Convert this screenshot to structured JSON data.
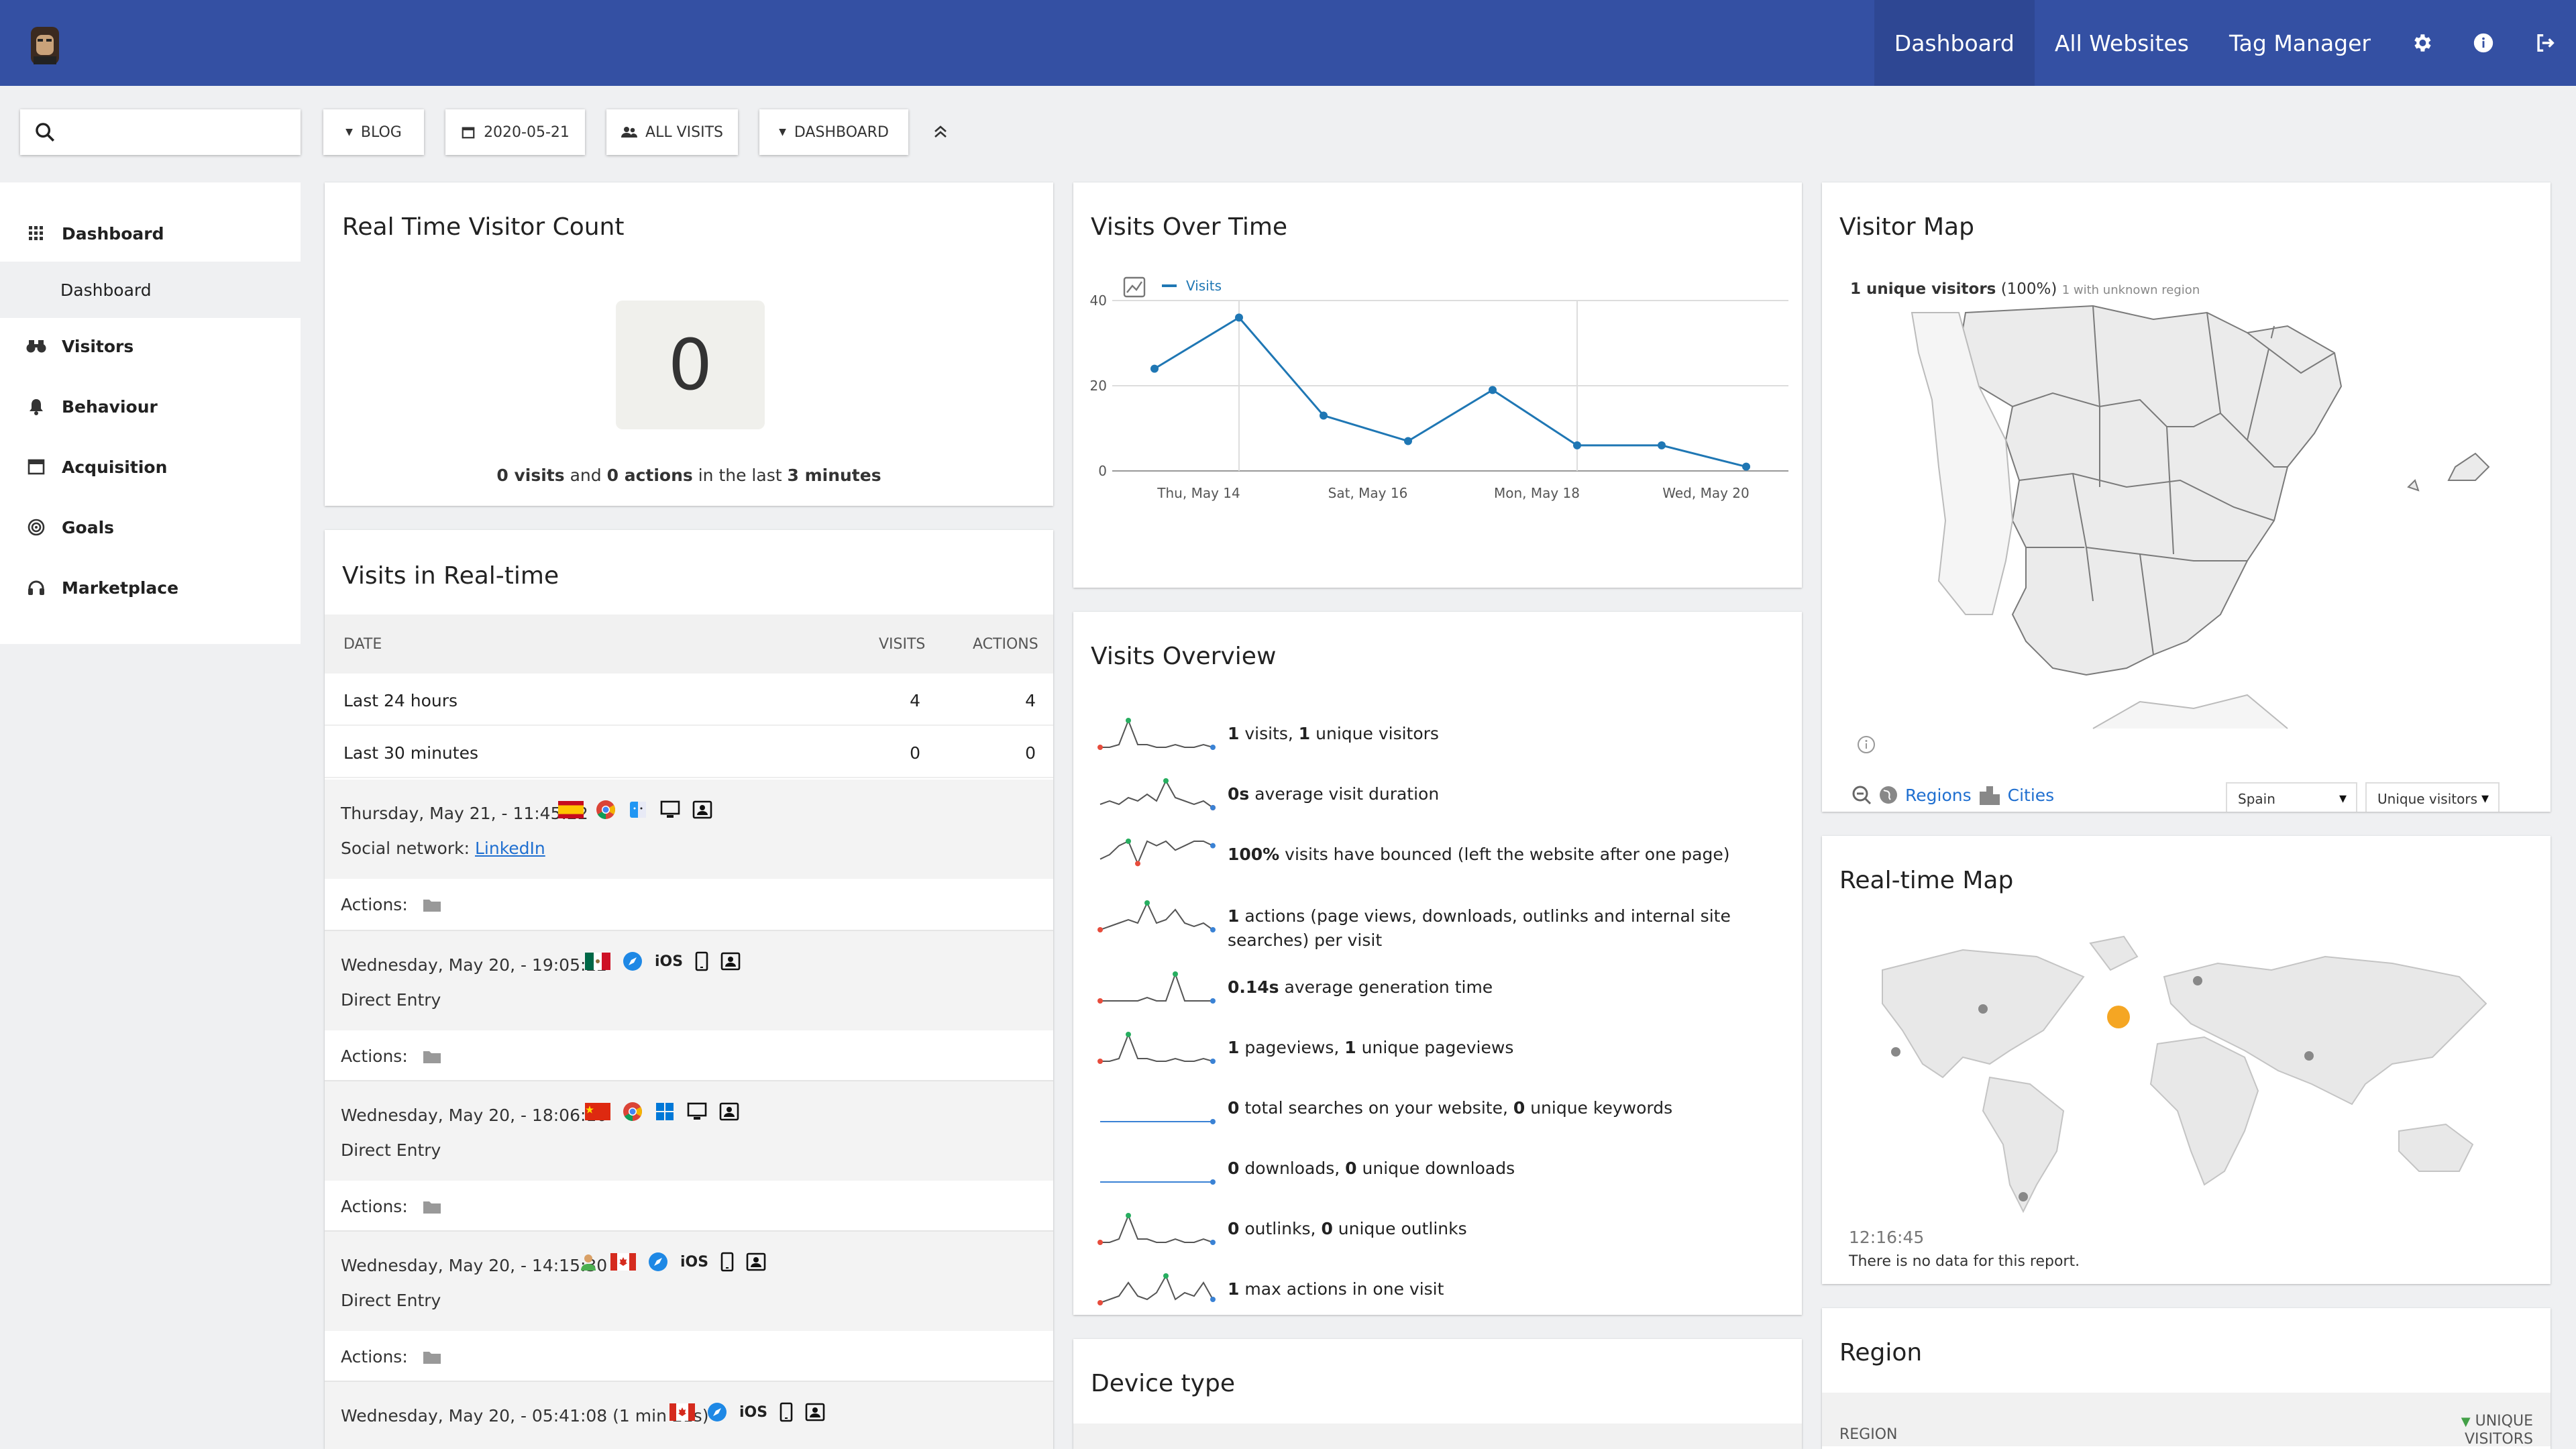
{
  "nav": {
    "links": [
      "Dashboard",
      "All Websites",
      "Tag Manager"
    ],
    "icons": [
      "gear-icon",
      "info-icon",
      "logout-icon"
    ]
  },
  "toolbar": {
    "search_placeholder": "",
    "site": "BLOG",
    "date": "2020-05-21",
    "segment": "ALL VISITS",
    "dashboard": "DASHBOARD"
  },
  "sidebar": {
    "dashboard": "Dashboard",
    "dashboard_sub": "Dashboard",
    "visitors": "Visitors",
    "behaviour": "Behaviour",
    "acquisition": "Acquisition",
    "goals": "Goals",
    "marketplace": "Marketplace"
  },
  "realtime_count": {
    "title": "Real Time Visitor Count",
    "value": "0",
    "visits": "0 visits",
    "and": "and",
    "actions": "0 actions",
    "in_the_last": "in the last",
    "minutes": "3 minutes"
  },
  "visits_realtime": {
    "title": "Visits in Real-time",
    "col_date": "DATE",
    "col_visits": "VISITS",
    "col_actions": "ACTIONS",
    "rows": [
      {
        "label": "Last 24 hours",
        "visits": "4",
        "actions": "4"
      },
      {
        "label": "Last 30 minutes",
        "visits": "0",
        "actions": "0"
      }
    ],
    "visits": [
      {
        "time": "Thursday, May 21, - 11:45:22",
        "referrer_prefix": "Social network:",
        "referrer_link": "LinkedIn",
        "actions": "Actions:",
        "os": ""
      },
      {
        "time": "Wednesday, May 20, - 19:05:22",
        "referrer": "Direct Entry",
        "actions": "Actions:",
        "os": "iOS"
      },
      {
        "time": "Wednesday, May 20, - 18:06:10",
        "referrer": "Direct Entry",
        "actions": "Actions:",
        "os": ""
      },
      {
        "time": "Wednesday, May 20, - 14:15:30",
        "referrer": "Direct Entry",
        "actions": "Actions:",
        "os": "iOS"
      },
      {
        "time": "Wednesday, May 20, - 05:41:08 (1 min 21s)",
        "referrer": "",
        "actions": "",
        "os": "iOS"
      }
    ]
  },
  "visits_over_time": {
    "title": "Visits Over Time",
    "chart_data": {
      "type": "line",
      "series": [
        {
          "name": "Visits",
          "values": [
            24,
            36,
            13,
            7,
            19,
            6,
            6,
            1
          ]
        }
      ],
      "x": [
        "May 13",
        "May 14",
        "May 15",
        "May 16",
        "May 17",
        "May 18",
        "May 19",
        "May 20"
      ],
      "x_tick_labels": [
        "Thu, May 14",
        "Sat, May 16",
        "Mon, May 18",
        "Wed, May 20"
      ],
      "y_tick_labels": [
        "0",
        "20",
        "40"
      ],
      "ylim": [
        0,
        40
      ],
      "grid": true,
      "color": "#1f77b4"
    }
  },
  "visits_overview": {
    "title": "Visits Overview",
    "rows": [
      {
        "b1": "1",
        "t1": " visits, ",
        "b2": "1",
        "t2": " unique visitors"
      },
      {
        "b1": "0s",
        "t1": " average visit duration",
        "b2": "",
        "t2": ""
      },
      {
        "b1": "100%",
        "t1": " visits have bounced (left the website after one page)",
        "b2": "",
        "t2": ""
      },
      {
        "b1": "1",
        "t1": " actions (page views, downloads, outlinks and internal site searches) per visit",
        "b2": "",
        "t2": ""
      },
      {
        "b1": "0.14s",
        "t1": " average generation time",
        "b2": "",
        "t2": ""
      },
      {
        "b1": "1",
        "t1": " pageviews, ",
        "b2": "1",
        "t2": " unique pageviews"
      },
      {
        "b1": "0",
        "t1": " total searches on your website, ",
        "b2": "0",
        "t2": " unique keywords"
      },
      {
        "b1": "0",
        "t1": " downloads, ",
        "b2": "0",
        "t2": " unique downloads"
      },
      {
        "b1": "0",
        "t1": " outlinks, ",
        "b2": "0",
        "t2": " unique outlinks"
      },
      {
        "b1": "1",
        "t1": " max actions in one visit",
        "b2": "",
        "t2": ""
      }
    ]
  },
  "device_type": {
    "title": "Device type"
  },
  "visitor_map": {
    "title": "Visitor Map",
    "summary_bold": "1 unique visitors",
    "summary_pct": "(100%)",
    "summary_small": "1 with unknown region",
    "regions": "Regions",
    "cities": "Cities",
    "country_select": "Spain",
    "metric_select": "Unique visitors"
  },
  "realtime_map": {
    "title": "Real-time Map",
    "time": "12:16:45",
    "nodata": "There is no data for this report."
  },
  "region": {
    "title": "Region",
    "col_region": "REGION",
    "col_unique1": "UNIQUE",
    "col_unique2": "VISITORS"
  },
  "colors": {
    "nav": "#3450a3",
    "nav_active": "#2e4793",
    "accent": "#1f77b4"
  }
}
